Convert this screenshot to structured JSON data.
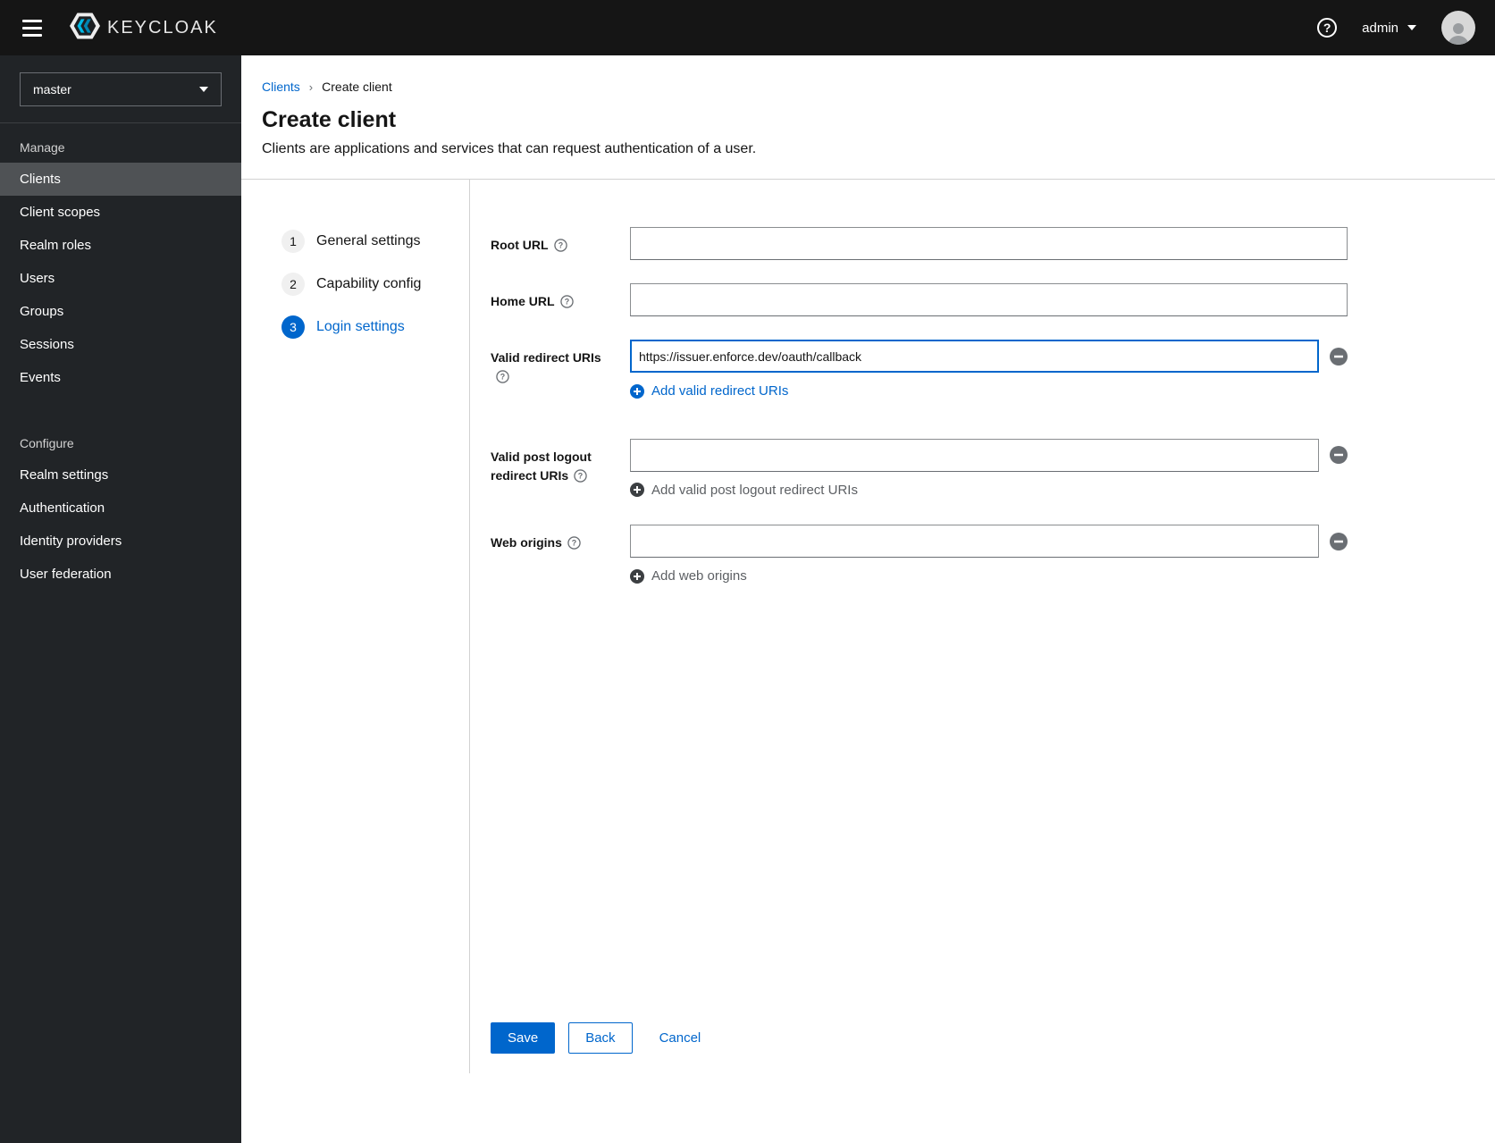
{
  "topbar": {
    "brand": "KEYCLOAK",
    "user_label": "admin"
  },
  "sidebar": {
    "realm": "master",
    "manage_label": "Manage",
    "manage_items": [
      "Clients",
      "Client scopes",
      "Realm roles",
      "Users",
      "Groups",
      "Sessions",
      "Events"
    ],
    "configure_label": "Configure",
    "configure_items": [
      "Realm settings",
      "Authentication",
      "Identity providers",
      "User federation"
    ]
  },
  "breadcrumb": {
    "parent": "Clients",
    "current": "Create client"
  },
  "page": {
    "title": "Create client",
    "subtitle": "Clients are applications and services that can request authentication of a user."
  },
  "wizard": {
    "steps": [
      {
        "num": "1",
        "label": "General settings"
      },
      {
        "num": "2",
        "label": "Capability config"
      },
      {
        "num": "3",
        "label": "Login settings"
      }
    ]
  },
  "form": {
    "root_url_label": "Root URL",
    "root_url_value": "",
    "home_url_label": "Home URL",
    "home_url_value": "",
    "redirect_label": "Valid redirect URIs",
    "redirect_value": "https://issuer.enforce.dev/oauth/callback",
    "redirect_add": "Add valid redirect URIs",
    "post_logout_label": "Valid post logout redirect URIs",
    "post_logout_value": "",
    "post_logout_add": "Add valid post logout redirect URIs",
    "web_origins_label": "Web origins",
    "web_origins_value": "",
    "web_origins_add": "Add web origins"
  },
  "actions": {
    "save": "Save",
    "back": "Back",
    "cancel": "Cancel"
  },
  "colors": {
    "primary": "#0066cc",
    "masthead": "#151515",
    "sidebar_bg": "#212427",
    "selected_item_bg": "#4f5255"
  }
}
